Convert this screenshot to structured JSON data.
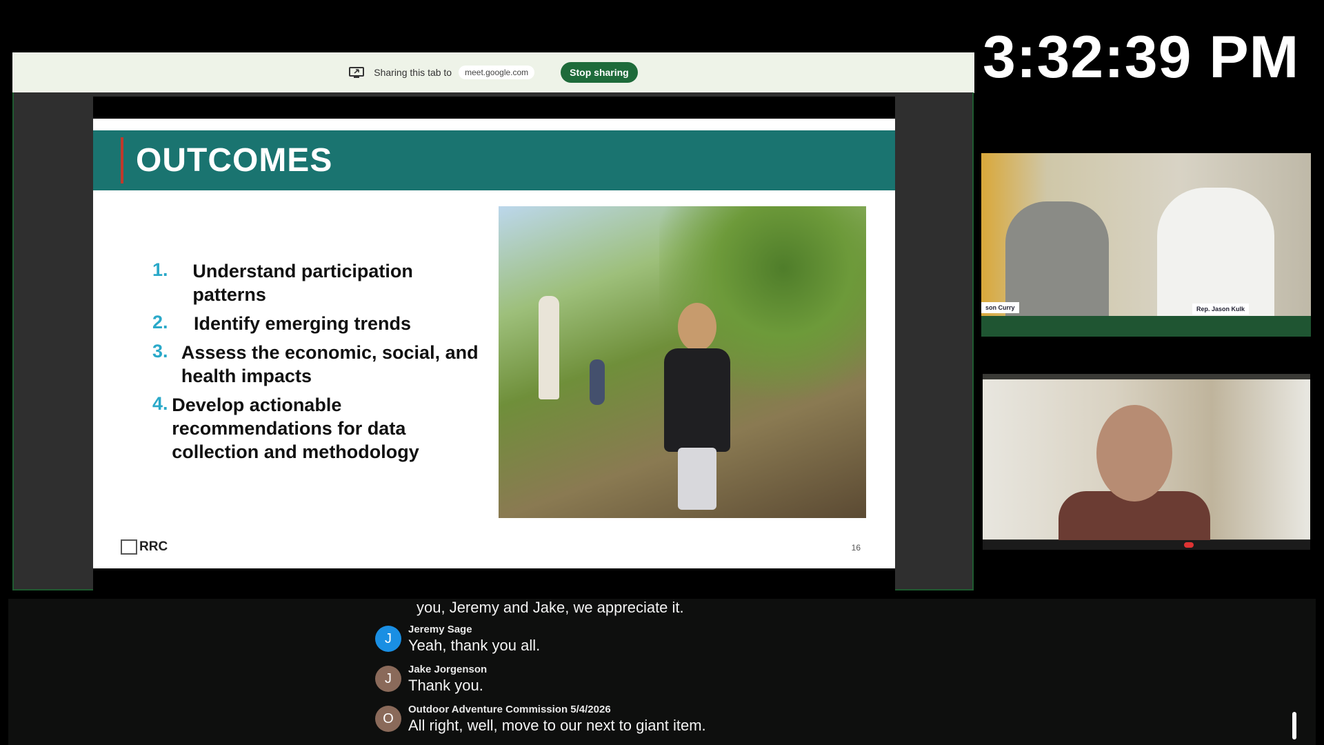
{
  "clock": "3:32:39 PM",
  "share_bar": {
    "text": "Sharing this tab to",
    "domain": "meet.google.com",
    "stop_label": "Stop sharing",
    "icon": "screen-share-icon"
  },
  "slide": {
    "title": "OUTCOMES",
    "items": [
      {
        "num": "1.",
        "text": "Understand participation patterns"
      },
      {
        "num": "2.",
        "text": "Identify emerging trends"
      },
      {
        "num": "3.",
        "text": "Assess the economic, social, and health impacts"
      },
      {
        "num": "4.",
        "text": "Develop actionable recommendations for data collection and methodology"
      }
    ],
    "logo": "RRC",
    "page": "16",
    "colors": {
      "header": "#1a7470",
      "numbers": "#2aa9c9",
      "accent_bar": "#c0392b"
    }
  },
  "video_room": {
    "placard_left": "son Curry",
    "placard_right": "Rep. Jason Kulk"
  },
  "captions": {
    "partial": "you, Jeremy and Jake, we appreciate it.",
    "entries": [
      {
        "initial": "J",
        "name": "Jeremy Sage",
        "text": "Yeah, thank you all.",
        "color": "#1a8fe3"
      },
      {
        "initial": "J",
        "name": "Jake Jorgenson",
        "text": "Thank you.",
        "color": "#8a6a5a"
      },
      {
        "initial": "O",
        "name": "Outdoor Adventure Commission 5/4/2026",
        "text": "All right, well, move to our next to giant item.",
        "color": "#8a6a5a"
      }
    ]
  }
}
